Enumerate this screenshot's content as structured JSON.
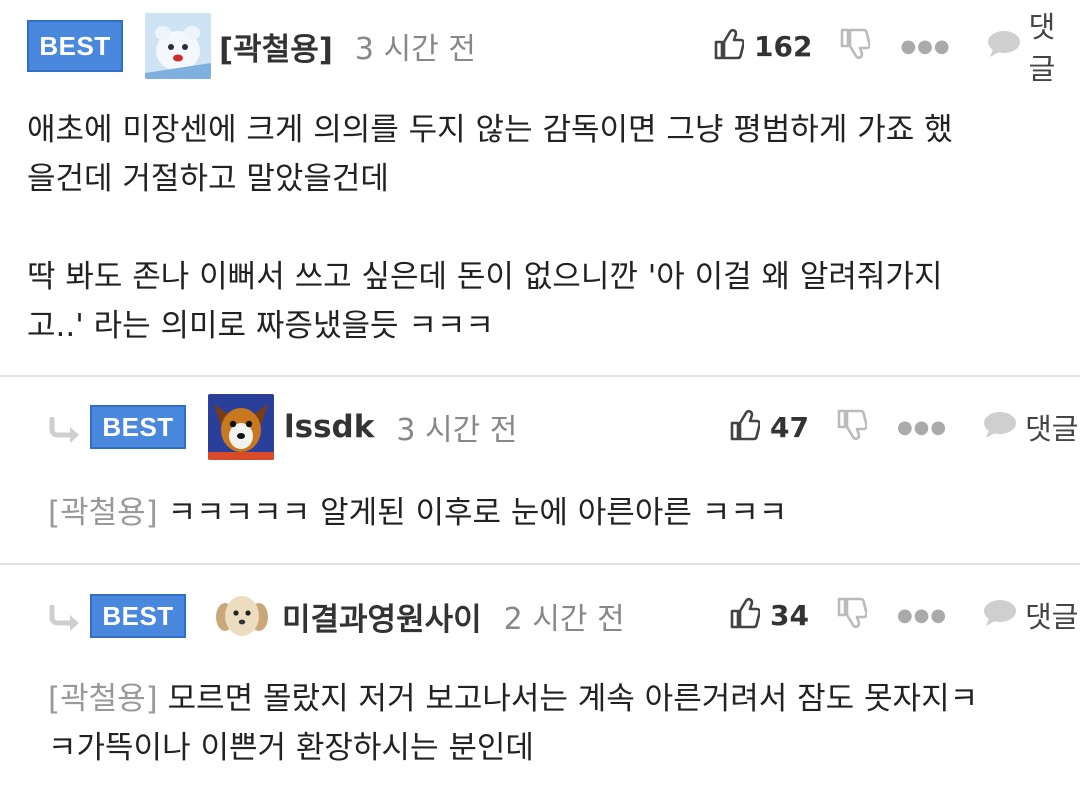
{
  "comments": [
    {
      "badge": "BEST",
      "username": "[곽철용]",
      "time": "3 시간 전",
      "likes": "162",
      "reply_label": "댓글",
      "lines": [
        "애초에 미장센에 크게 의의를 두지 않는 감독이면 그냥 평범하게 가죠 했",
        "을건데 거절하고 말았을건데",
        "",
        "딱 봐도 존나 이뻐서 쓰고 싶은데 돈이 없으니깐 '아 이걸 왜 알려줘가지",
        "고..' 라는 의미로 짜증냈을듯 ㅋㅋㅋ"
      ]
    },
    {
      "badge": "BEST",
      "username": "lssdk",
      "time": "3 시간 전",
      "likes": "47",
      "reply_label": "댓글",
      "reply_to": "[곽철용]",
      "lines": [
        "ㅋㅋㅋㅋㅋ 알게된 이후로 눈에 아른아른 ㅋㅋㅋ"
      ]
    },
    {
      "badge": "BEST",
      "username": "미결과영원사이",
      "time": "2 시간 전",
      "likes": "34",
      "reply_label": "댓글",
      "reply_to": "[곽철용]",
      "lines": [
        "모르면 몰랐지 저거 보고나서는 계속 아른거려서 잠도 못자지ㅋ",
        "ㅋ가뜩이나 이쁜거 환장하시는 분인데"
      ]
    }
  ],
  "icons": {
    "like": "thumbs-up-icon",
    "dislike": "thumbs-down-icon",
    "more": "more-dots-icon",
    "reply": "speech-bubble-icon",
    "reply_arrow": "reply-arrow-icon"
  },
  "colors": {
    "badge": "#4a88dd",
    "divider": "#e3e3e3",
    "muted": "#888888",
    "icon": "#444444"
  }
}
